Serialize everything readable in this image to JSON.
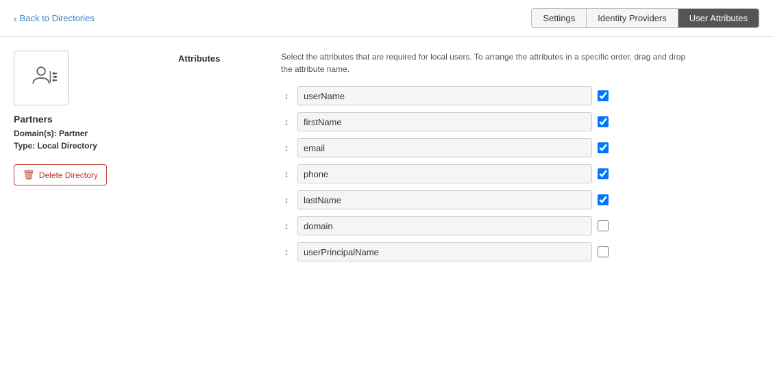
{
  "header": {
    "back_label": "Back to Directories",
    "tabs": [
      {
        "id": "settings",
        "label": "Settings",
        "active": false
      },
      {
        "id": "identity-providers",
        "label": "Identity Providers",
        "active": false
      },
      {
        "id": "user-attributes",
        "label": "User Attributes",
        "active": true
      }
    ]
  },
  "sidebar": {
    "directory_name": "Partners",
    "domain_label": "Domain(s):",
    "domain_value": "Partner",
    "type_label": "Type:",
    "type_value": "Local Directory",
    "delete_label": "Delete Directory"
  },
  "content": {
    "section_label": "Attributes",
    "description": "Select the attributes that are required for local users. To arrange the attributes in a specific order, drag and drop the attribute name.",
    "attributes": [
      {
        "name": "userName",
        "checked": true,
        "disabled": false
      },
      {
        "name": "firstName",
        "checked": true,
        "disabled": false
      },
      {
        "name": "email",
        "checked": true,
        "disabled": false
      },
      {
        "name": "phone",
        "checked": true,
        "disabled": false
      },
      {
        "name": "lastName",
        "checked": true,
        "disabled": false
      },
      {
        "name": "domain",
        "checked": false,
        "disabled": false
      },
      {
        "name": "userPrincipalName",
        "checked": false,
        "disabled": false
      }
    ]
  }
}
